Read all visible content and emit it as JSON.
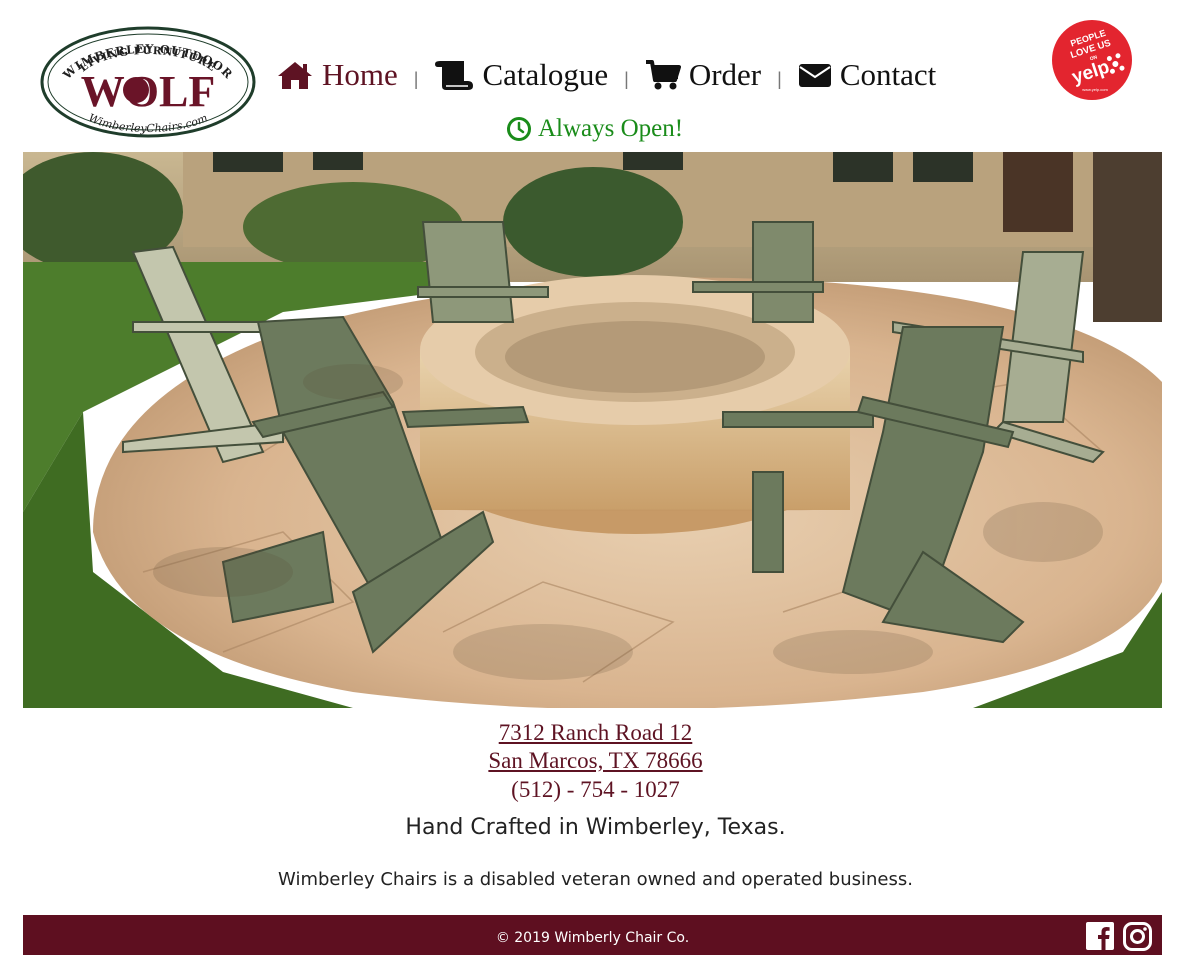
{
  "header": {
    "logo": {
      "line1": "WIMBERLEY OUTDOOR",
      "line2": "LIVING FURNITURE",
      "brand": "WOLF",
      "site": "WimberleyChairs.com"
    },
    "nav": [
      {
        "label": "Home",
        "icon": "home-icon"
      },
      {
        "label": "Catalogue",
        "icon": "scroll-icon"
      },
      {
        "label": "Order",
        "icon": "cart-icon"
      },
      {
        "label": "Contact",
        "icon": "envelope-icon"
      }
    ],
    "separator": "|",
    "status": "Always Open!",
    "yelp_badge": {
      "line1": "PEOPLE",
      "line2": "LOVE US",
      "line3": "ON",
      "brand": "yelp",
      "url_text": "www.yelp.com"
    }
  },
  "address": {
    "street": "7312 Ranch Road 12",
    "city": "San Marcos, TX 78666",
    "phone": "(512) - 754 - 1027"
  },
  "tagline": "Hand Crafted in Wimberley, Texas.",
  "note": "Wimberley Chairs is a disabled veteran owned and operated business.",
  "footer": {
    "copyright": "© 2019 Wimberly Chair Co.",
    "social": [
      "facebook-icon",
      "instagram-icon"
    ]
  },
  "colors": {
    "brand": "#5e1323",
    "status": "#1a8c1a",
    "footer": "#5e0f20",
    "yelp": "#e3252f"
  }
}
